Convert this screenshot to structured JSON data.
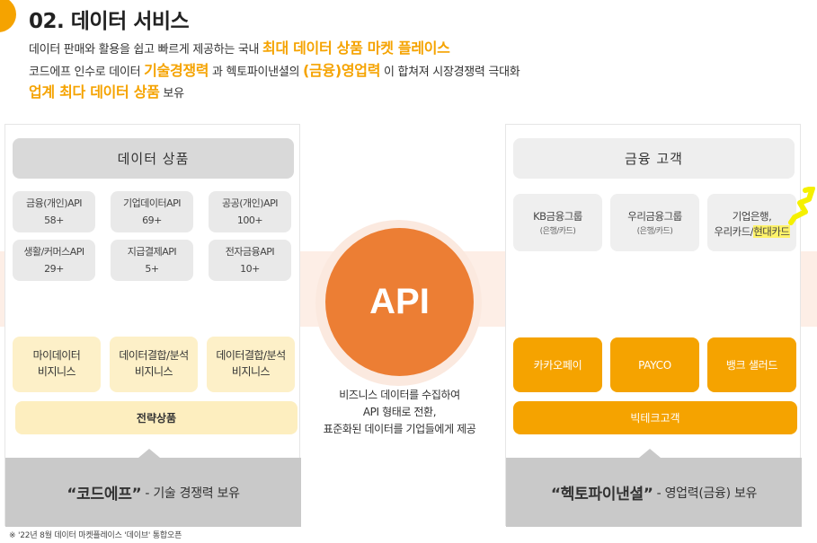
{
  "heading": {
    "title": "02. 데이터 서비스"
  },
  "intro": {
    "line1_a": "데이터 판매와 활용을 쉽고 빠르게 제공하는 국내 ",
    "line1_hl": "최대 데이터 상품 마켓 플레이스",
    "line2_a": "코드에프 인수로 데이터 ",
    "line2_hl1": "기술경쟁력",
    "line2_b": " 과 헥토파이낸셜의 ",
    "line2_hl2": "(금융)영업력",
    "line2_c": " 이 합쳐져 시장경쟁력 극대화",
    "line3_hl": "업계 최다 데이터 상품",
    "line3_a": " 보유"
  },
  "left_panel": {
    "header": "데이터 상품",
    "categories": [
      {
        "name": "금융(개인)API",
        "count": "58+"
      },
      {
        "name": "기업데이터API",
        "count": "69+"
      },
      {
        "name": "공공(개인)API",
        "count": "100+"
      },
      {
        "name": "생활/커머스API",
        "count": "29+"
      },
      {
        "name": "지급결제API",
        "count": "5+"
      },
      {
        "name": "전자금융API",
        "count": "10+"
      }
    ],
    "business": [
      {
        "line1": "마이데이터",
        "line2": "비지니스"
      },
      {
        "line1": "데이터결합/분석",
        "line2": "비지니스"
      },
      {
        "line1": "데이터결합/분석",
        "line2": "비지니스"
      }
    ],
    "strategy": "전략상품",
    "footer_bold": "“코드에프”",
    "footer_rest": "- 기술 경쟁력 보유"
  },
  "center": {
    "api_label": "API",
    "desc_line1": "비즈니스 데이터를 수집하여",
    "desc_line2": "API 형태로 전환,",
    "desc_line3": "표준화된 데이터를 기업들에게 제공"
  },
  "right_panel": {
    "header": "금융 고객",
    "banks": [
      {
        "line1": "KB금융그룹",
        "line2": "(은행/카드)"
      },
      {
        "line1": "우리금융그룹",
        "line2": "(은행/카드)"
      },
      {
        "line1": "기업은행,",
        "line2a": "우리카드/",
        "line2b": "현대카드"
      }
    ],
    "payments": [
      "카카오페이",
      "PAYCO",
      "뱅크 샐러드"
    ],
    "bigtech": "빅테크고객",
    "footer_bold": "“헥토파이낸셜”",
    "footer_rest": "- 영업력(금융) 보유"
  },
  "footnote": "※ '22년 8월 데이터 마켓플레이스 '데이브' 통합오픈",
  "colors": {
    "accent": "#f5a300",
    "api": "#ec7e34",
    "band": "#fdeee6"
  }
}
